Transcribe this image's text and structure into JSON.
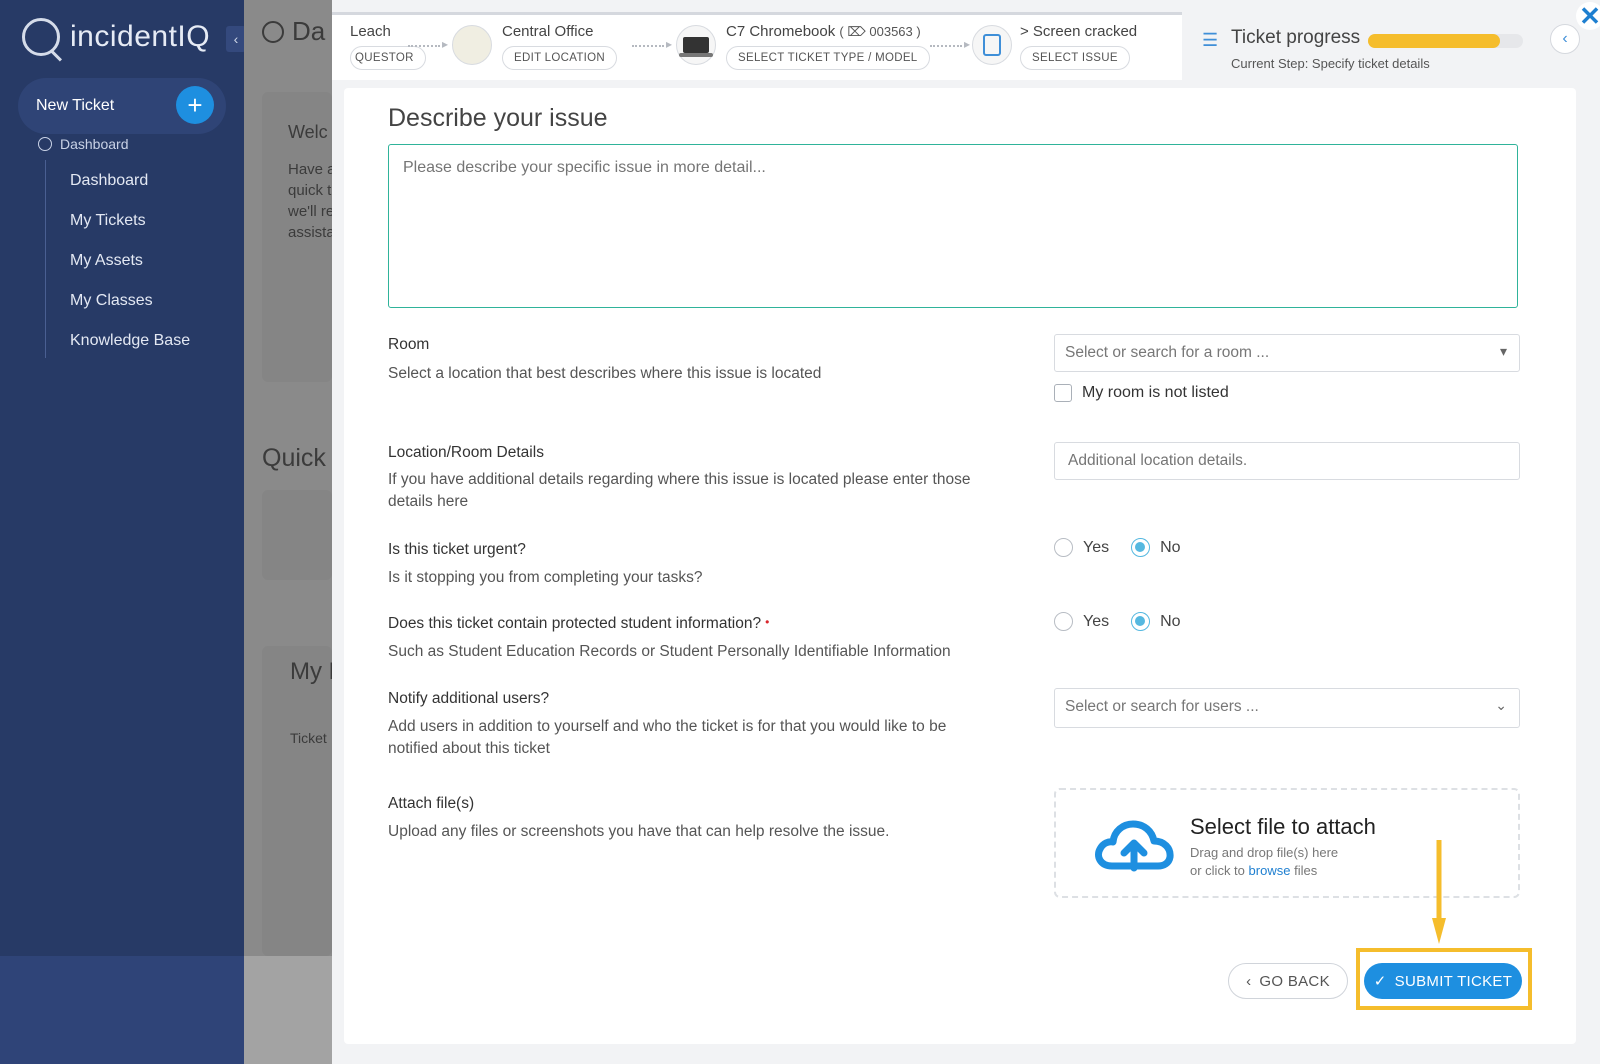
{
  "app": {
    "logo_text": "incidentIQ",
    "collapse_label": "‹"
  },
  "sidebar": {
    "new_ticket_label": "New Ticket",
    "new_ticket_plus": "+",
    "section_label": "Dashboard",
    "items": [
      {
        "label": "Dashboard"
      },
      {
        "label": "My Tickets"
      },
      {
        "label": "My Assets"
      },
      {
        "label": "My Classes"
      },
      {
        "label": "Knowledge Base"
      }
    ]
  },
  "background": {
    "page_title": "Da",
    "welcome_title": "Welc",
    "welcome_lines": [
      "Have a",
      "quick t",
      "we'll re",
      "assista"
    ],
    "quick_title": "Quick T",
    "my_title": "My F",
    "ticket_col": "Ticket"
  },
  "steps": {
    "requestor_name": "Leach",
    "requestor_pill": "QUESTOR",
    "location_name": "Central Office",
    "location_pill": "EDIT LOCATION",
    "device_name": "C7 Chromebook",
    "device_tag_open": "(",
    "device_tag_icon": "⃝",
    "device_tag": "003563",
    "device_tag_close": ")",
    "device_pill": "SELECT TICKET TYPE / MODEL",
    "issue_name": "> Screen cracked",
    "issue_pill": "SELECT ISSUE"
  },
  "progress": {
    "title": "Ticket progress",
    "current_step": "Current Step: Specify ticket details",
    "percent": 0.85,
    "color": "#f5bd2c"
  },
  "form": {
    "section_title": "Describe your issue",
    "description_placeholder": "Please describe your specific issue in more detail...",
    "room": {
      "label": "Room",
      "help": "Select a location that best describes where this issue is located",
      "placeholder": "Select or search for a room ...",
      "not_listed_label": "My room is not listed"
    },
    "location_details": {
      "label": "Location/Room Details",
      "help": "If you have additional details regarding where this issue is located please enter those details here",
      "placeholder": "Additional location details."
    },
    "urgent": {
      "label": "Is this ticket urgent?",
      "help": "Is it stopping you from completing your tasks?",
      "yes": "Yes",
      "no": "No",
      "selected": "No"
    },
    "protected": {
      "label": "Does this ticket contain protected student information?",
      "required_mark": "•",
      "help": "Such as Student Education Records or Student Personally Identifiable Information",
      "yes": "Yes",
      "no": "No",
      "selected": "No"
    },
    "notify": {
      "label": "Notify additional users?",
      "help": "Add users in addition to yourself and who the ticket is for that you would like to be notified about this ticket",
      "placeholder": "Select or search for users ..."
    },
    "attach": {
      "label": "Attach file(s)",
      "help": "Upload any files or screenshots you have that can help resolve the issue.",
      "dropzone_title": "Select file to attach",
      "dropzone_line1": "Drag and drop file(s) here",
      "dropzone_line2_prefix": "or click to",
      "dropzone_link": "browse",
      "dropzone_line2_suffix": "files"
    }
  },
  "actions": {
    "go_back": "GO BACK",
    "submit": "SUBMIT TICKET"
  },
  "colors": {
    "sidebar": "#273a66",
    "accent": "#1e8fe0",
    "highlight": "#f5bd2c",
    "focus_border": "#2fb39a"
  }
}
